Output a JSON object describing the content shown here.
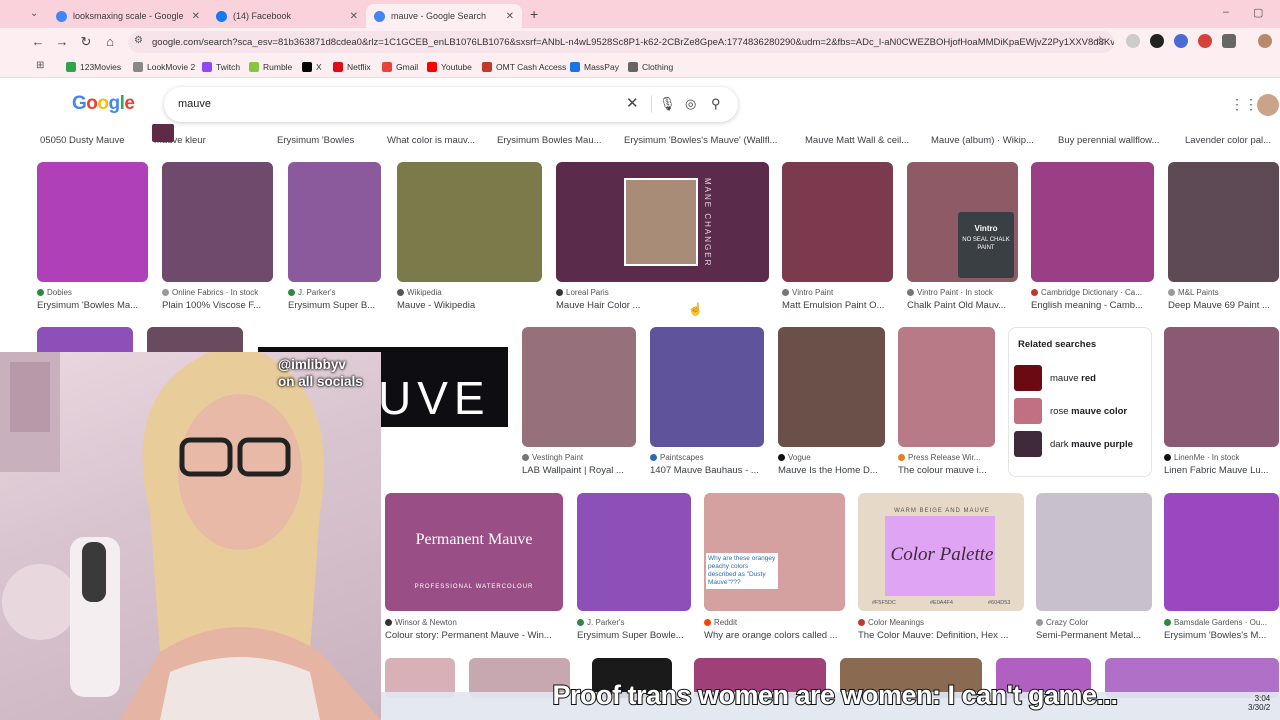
{
  "browser": {
    "tabs": [
      {
        "title": "looksmaxing scale - Google Sea",
        "favicon_color": "#4285f4"
      },
      {
        "title": "(14) Facebook",
        "favicon_color": "#1877f2"
      },
      {
        "title": "mauve - Google Search",
        "favicon_color": "#4285f4",
        "active": true
      }
    ],
    "url": "google.com/search?sca_esv=81b363871d8cdea0&rlz=1C1GCEB_enLB1076LB1076&sxsrf=ANbL-n4wL9528Sc8P1-k62-2CBrZe8GpeA:1774836280290&udm=2&fbs=ADc_l-aN0CWEZBOHjofHoaMMDiKpaEWjvZ2Py1XXV8d8KvlI3...",
    "bookmarks": [
      "123Movies",
      "LookMovie 2",
      "Twitch",
      "Rumble",
      "X",
      "Netflix",
      "Gmail",
      "Youtube",
      "OMT Cash Access",
      "MassPay",
      "Clothing"
    ],
    "bookmark_colors": [
      "#2ea44f",
      "#888",
      "#9146ff",
      "#85c742",
      "#000",
      "#e50914",
      "#ea4335",
      "#ff0000",
      "#c0392b",
      "#1a73e8",
      "#666"
    ]
  },
  "google": {
    "logo": "Google",
    "query": "mauve"
  },
  "row0": [
    {
      "cap": "05050 Dusty Mauve"
    },
    {
      "cap": "mauve kleur"
    },
    {
      "cap": "Erysimum 'Bowles"
    },
    {
      "cap": "What color is mauv..."
    },
    {
      "cap": "Erysimum Bowles Mau..."
    },
    {
      "cap": "Erysimum 'Bowles's Mauve' (Wallfl..."
    },
    {
      "cap": "Mauve Matt Wall & ceil..."
    },
    {
      "cap": "Mauve (album) · Wikip..."
    },
    {
      "cap": "Buy perennial wallflow..."
    },
    {
      "cap": "Lavender color pal..."
    }
  ],
  "row1": [
    {
      "src": "Dobies",
      "cap": "Erysimum 'Bowles Ma...",
      "color": "#b040b8",
      "dot": "#2b8a3e"
    },
    {
      "src": "Online Fabrics · In stock",
      "cap": "Plain 100% Viscose F...",
      "color": "#6f4a6c",
      "dot": "#999"
    },
    {
      "src": "J. Parker's",
      "cap": "Erysimum Super B...",
      "color": "#8a5a9c",
      "dot": "#2b8a3e"
    },
    {
      "src": "Wikipedia",
      "cap": "Mauve - Wikipedia",
      "color": "#7a7a4a",
      "dot": "#555"
    },
    {
      "src": "Loreal Paris",
      "cap": "Mauve Hair Color ...",
      "color": "#5a2b4a",
      "dot": "#333"
    },
    {
      "src": "Vintro Paint",
      "cap": "Matt Emulsion Paint O...",
      "color": "#7b3a4e",
      "dot": "#777"
    },
    {
      "src": "Vintro Paint · In stock",
      "cap": "Chalk Paint Old Mauv...",
      "color": "#8d5a66",
      "dot": "#777"
    },
    {
      "src": "Cambridge Dictionary · Ca...",
      "cap": "English meaning - Camb...",
      "color": "#9a3f86",
      "dot": "#c0392b"
    },
    {
      "src": "M&L Paints",
      "cap": "Deep Mauve 69 Paint ...",
      "color": "#5e4a54",
      "dot": "#999"
    }
  ],
  "row2": [
    {
      "src": "Vestingh Paint",
      "cap": "LAB Wallpaint | Royal ...",
      "color": "#96707a",
      "dot": "#777"
    },
    {
      "src": "Paintscapes",
      "cap": "1407 Mauve Bauhaus - ...",
      "color": "#5f549c",
      "dot": "#2b6cb0"
    },
    {
      "src": "Vogue",
      "cap": "Mauve Is the Home D...",
      "color": "#6a5048",
      "dot": "#111"
    },
    {
      "src": "Press Release Wir...",
      "cap": "The colour mauve i...",
      "color": "#b87a86",
      "dot": "#e67e22"
    },
    {
      "src": "LinenMe · In stock",
      "cap": "Linen Fabric Mauve Lu...",
      "color": "#8a5a72",
      "dot": "#111"
    }
  ],
  "album_text": "UVE",
  "related": {
    "title": "Related searches",
    "items": [
      {
        "pre": "mauve ",
        "bold": "red",
        "color": "#6b0a12"
      },
      {
        "pre": "rose ",
        "bold": "mauve color",
        "color": "#c07080"
      },
      {
        "pre": "dark ",
        "bold": "mauve purple",
        "color": "#3e2a3a"
      }
    ]
  },
  "row3": [
    {
      "src": "Winsor & Newton",
      "cap": "Colour story: Permanent Mauve - Win...",
      "color": "#9a4e86",
      "dot": "#333"
    },
    {
      "src": "J. Parker's",
      "cap": "Erysimum Super Bowle...",
      "color": "#8d50b8",
      "dot": "#2b8a3e"
    },
    {
      "src": "Reddit",
      "cap": "Why are orange colors called ...",
      "color": "#d4a0a0",
      "dot": "#ff4500"
    },
    {
      "src": "Color Meanings",
      "cap": "The Color Mauve: Definition, Hex ...",
      "color": "#e6d9c8",
      "dot": "#c0392b"
    },
    {
      "src": "Crazy Color",
      "cap": "Semi-Permanent Metal...",
      "color": "#c8c0cc",
      "dot": "#999"
    },
    {
      "src": "Bamsdale Gardens · Ou...",
      "cap": "Erysimum 'Bowles's M...",
      "color": "#9a48c0",
      "dot": "#2b8a3e"
    }
  ],
  "wc_text": {
    "title": "Permanent Mauve",
    "sub": "PROFESSIONAL WATERCOLOUR"
  },
  "palette_text": {
    "top": "WARM BEIGE AND MAUVE",
    "title": "Color Palette",
    "codes": [
      "#F5F5DC",
      "#E0A4F4",
      "#604D53"
    ]
  },
  "reddit_text": "Why are these orangey peachy colors described as \"Dusty Mauve\"???",
  "hair_text": "MANE CHANGER",
  "paint_text": {
    "brand": "Vintro",
    "sub": "NO SEAL CHALK PAINT"
  },
  "overlay": {
    "handle_line1": "@imlibbyv",
    "handle_line2": "on all socials",
    "caption": "Proof trans women are women: I can't game..."
  },
  "taskbar": {
    "time": "3:04",
    "date": "3/30/2"
  }
}
